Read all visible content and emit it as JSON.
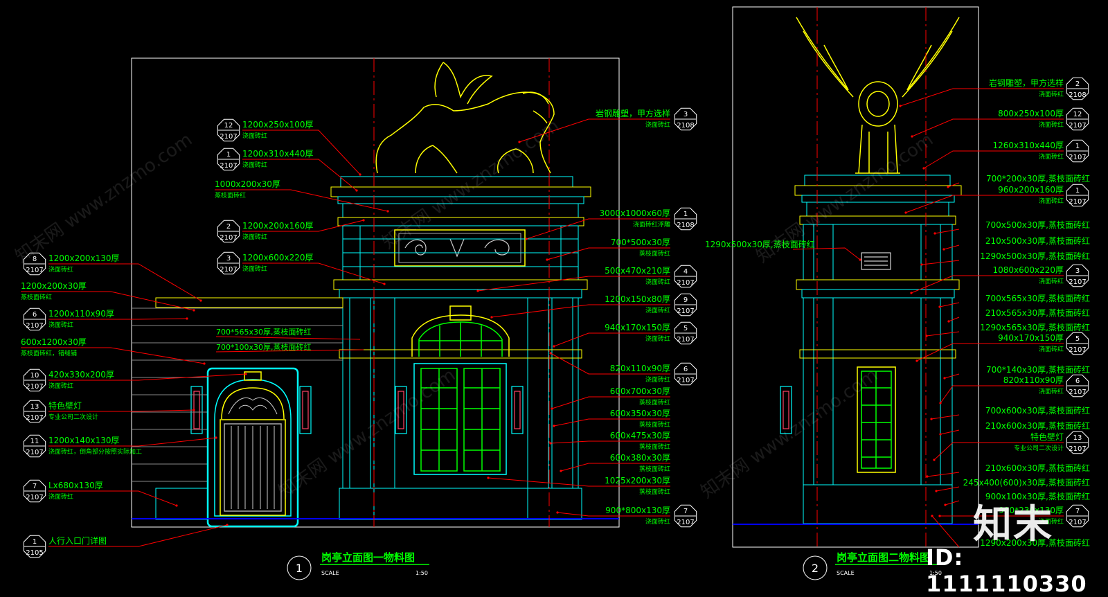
{
  "drawing": {
    "left_title": "岗亭立面图一物料图",
    "right_title": "岗亭立面图二物料图",
    "left_title_num": "1",
    "right_title_num": "2",
    "scale_label": "SCALE",
    "scale_value": "1:50"
  },
  "watermark": {
    "site": "知末网 www.znzmo.com",
    "brand": "知末",
    "id": "ID: 1111110330"
  },
  "callouts_left": [
    {
      "num": "12",
      "code": "2107",
      "text": "1200x250x100厚",
      "sub": "浇面砖红"
    },
    {
      "num": "1",
      "code": "2107",
      "text": "1200x310x440厚",
      "sub": "浇面砖红"
    },
    {
      "num": "",
      "code": "",
      "text": "1000x200x30厚",
      "sub": "蒸枝面砖红"
    },
    {
      "num": "2",
      "code": "2107",
      "text": "1200x200x160厚",
      "sub": "浇面砖红"
    },
    {
      "num": "3",
      "code": "2107",
      "text": "1200x600x220厚",
      "sub": "浇面砖红"
    },
    {
      "num": "8",
      "code": "2107",
      "text": "1200x200x130厚",
      "sub": "浇面砖红"
    },
    {
      "num": "",
      "code": "",
      "text": "1200x200x30厚",
      "sub": "蒸枝面砖红"
    },
    {
      "num": "6",
      "code": "2107",
      "text": "1200x110x90厚",
      "sub": "浇面砖红"
    },
    {
      "num": "",
      "code": "",
      "text": "600x1200x30厚",
      "sub": "蒸枝面砖红，错缝铺"
    },
    {
      "num": "10",
      "code": "2107",
      "text": "420x330x200厚",
      "sub": "浇面砖红"
    },
    {
      "num": "13",
      "code": "2107",
      "text": "特色壁灯",
      "sub": "专业公司二次设计"
    },
    {
      "num": "11",
      "code": "2107",
      "text": "1200x140x130厚",
      "sub": "浇面砖红，倒角部分按照实际加工"
    },
    {
      "num": "7",
      "code": "2107",
      "text": "Lx680x130厚",
      "sub": "浇面砖红"
    },
    {
      "num": "1",
      "code": "2105",
      "text": "人行入口门详图",
      "sub": ""
    }
  ],
  "callouts_inner": [
    {
      "text": "700*565x30厚,蒸枝面砖红"
    },
    {
      "text": "700*100x30厚,蒸枝面砖红"
    }
  ],
  "callouts_mid": [
    {
      "num": "3",
      "code": "2108",
      "text": "岩钢雕塑，甲方选样",
      "sub": "浇面砖红"
    },
    {
      "num": "1",
      "code": "2108",
      "text": "3000x1000x60厚",
      "sub": "浇面砖红浮雕"
    },
    {
      "num": "",
      "code": "",
      "text": "700*500x30厚",
      "sub": "蒸枝面砖红"
    },
    {
      "num": "4",
      "code": "2107",
      "text": "500x470x210厚",
      "sub": "浇面砖红"
    },
    {
      "num": "9",
      "code": "2107",
      "text": "1200x150x80厚",
      "sub": "浇面砖红"
    },
    {
      "num": "5",
      "code": "2107",
      "text": "940x170x150厚",
      "sub": "浇面砖红"
    },
    {
      "num": "6",
      "code": "2107",
      "text": "820x110x90厚",
      "sub": "浇面砖红"
    },
    {
      "num": "",
      "code": "",
      "text": "600x700x30厚",
      "sub": "蒸枝面砖红"
    },
    {
      "num": "",
      "code": "",
      "text": "600x350x30厚",
      "sub": "蒸枝面砖红"
    },
    {
      "num": "",
      "code": "",
      "text": "600x475x30厚",
      "sub": "蒸枝面砖红"
    },
    {
      "num": "",
      "code": "",
      "text": "600x380x30厚",
      "sub": "蒸枝面砖红"
    },
    {
      "num": "",
      "code": "",
      "text": "1025x200x30厚",
      "sub": "蒸枝面砖红"
    },
    {
      "num": "7",
      "code": "2107",
      "text": "900*800x130厚",
      "sub": "浇面砖红"
    }
  ],
  "callout_between": {
    "text": "1290x500x30厚,蒸枝面砖红"
  },
  "callouts_right": [
    {
      "num": "2",
      "code": "2108",
      "text": "岩钢雕塑，甲方选样",
      "sub": "浇面砖红"
    },
    {
      "num": "12",
      "code": "2107",
      "text": "800x250x100厚",
      "sub": "浇面砖红"
    },
    {
      "num": "1",
      "code": "2107",
      "text": "1260x310x440厚",
      "sub": "浇面砖红"
    },
    {
      "num": "",
      "code": "",
      "text": "700*200x30厚,蒸枝面砖红",
      "sub": ""
    },
    {
      "num": "1",
      "code": "2107",
      "text": "960x200x160厚",
      "sub": "浇面砖红"
    },
    {
      "num": "",
      "code": "",
      "text": "700x500x30厚,蒸枝面砖红",
      "sub": ""
    },
    {
      "num": "",
      "code": "",
      "text": "210x500x30厚,蒸枝面砖红",
      "sub": ""
    },
    {
      "num": "",
      "code": "",
      "text": "1290x500x30厚,蒸枝面砖红",
      "sub": ""
    },
    {
      "num": "3",
      "code": "2107",
      "text": "1080x600x220厚",
      "sub": "浇面砖红"
    },
    {
      "num": "",
      "code": "",
      "text": "700x565x30厚,蒸枝面砖红",
      "sub": ""
    },
    {
      "num": "",
      "code": "",
      "text": "210x565x30厚,蒸枝面砖红",
      "sub": ""
    },
    {
      "num": "",
      "code": "",
      "text": "1290x565x30厚,蒸枝面砖红",
      "sub": ""
    },
    {
      "num": "5",
      "code": "2107",
      "text": "940x170x150厚",
      "sub": "浇面砖红"
    },
    {
      "num": "",
      "code": "",
      "text": "700*140x30厚,蒸枝面砖红",
      "sub": ""
    },
    {
      "num": "6",
      "code": "2107",
      "text": "820x110x90厚",
      "sub": "浇面砖红"
    },
    {
      "num": "",
      "code": "",
      "text": "700x600x30厚,蒸枝面砖红",
      "sub": ""
    },
    {
      "num": "",
      "code": "",
      "text": "210x600x30厚,蒸枝面砖红",
      "sub": ""
    },
    {
      "num": "13",
      "code": "2107",
      "text": "特色壁灯",
      "sub": "专业公司二次设计"
    },
    {
      "num": "",
      "code": "",
      "text": "210x600x30厚,蒸枝面砖红",
      "sub": ""
    },
    {
      "num": "",
      "code": "",
      "text": "245x400(600)x30厚,蒸枝面砖红",
      "sub": ""
    },
    {
      "num": "",
      "code": "",
      "text": "900x100x30厚,蒸枝面砖红",
      "sub": ""
    },
    {
      "num": "7",
      "code": "2107",
      "text": "900*230x130厚",
      "sub": "浇面砖红"
    },
    {
      "num": "",
      "code": "",
      "text": "1290x200x30厚,蒸枝面砖红",
      "sub": ""
    }
  ],
  "colors": {
    "background": "#000000",
    "frame": "#ffffff",
    "label_text": "#00ff00",
    "tag": "#ffffff",
    "leader": "#ff0000",
    "axis": "#ff0000",
    "structure": "#00ffff",
    "ornament": "#ffff00",
    "ground": "#0000ff",
    "door": "#00ff00"
  }
}
